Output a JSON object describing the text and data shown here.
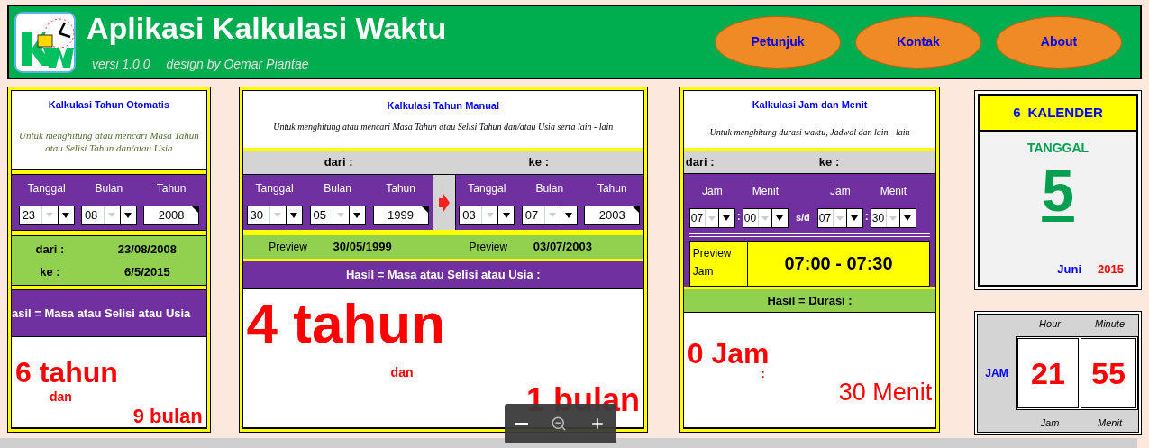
{
  "header": {
    "title": "Aplikasi Kalkulasi Waktu",
    "version": "versi 1.0.0",
    "credit": "design by Oemar Piantae",
    "nav": [
      "Petunjuk",
      "Kontak",
      "About"
    ]
  },
  "auto_panel": {
    "title": "Kalkulasi Tahun Otomatis",
    "description": "Untuk menghitung atau mencari Masa Tahun atau Selisi Tahun dan/atau Usia",
    "fields": [
      {
        "label": "Tanggal",
        "value": "23",
        "kind": "dropdown"
      },
      {
        "label": "Bulan",
        "value": "08",
        "kind": "dropdown"
      },
      {
        "label": "Tahun",
        "value": "2008",
        "kind": "input"
      }
    ],
    "summary": [
      {
        "label": "dari :",
        "value": "23/08/2008"
      },
      {
        "label": "ke :",
        "value": "6/5/2015"
      }
    ],
    "result_header": "asil = Masa atau Selisi atau Usia",
    "result": {
      "years": "6 tahun",
      "connector": "dan",
      "months": "9 bulan"
    }
  },
  "manual_panel": {
    "title": "Kalkulasi Tahun Manual",
    "description": "Untuk menghitung atau mencari Masa Tahun atau Selisi Tahun dan/atau Usia serta lain - lain",
    "from_label": "dari :",
    "to_label": "ke :",
    "from_fields": [
      {
        "label": "Tanggal",
        "value": "30",
        "kind": "dropdown"
      },
      {
        "label": "Bulan",
        "value": "05",
        "kind": "dropdown"
      },
      {
        "label": "Tahun",
        "value": "1999",
        "kind": "input"
      }
    ],
    "to_fields": [
      {
        "label": "Tanggal",
        "value": "03",
        "kind": "dropdown"
      },
      {
        "label": "Bulan",
        "value": "07",
        "kind": "dropdown"
      },
      {
        "label": "Tahun",
        "value": "2003",
        "kind": "input"
      }
    ],
    "previews": [
      {
        "label": "Preview",
        "value": "30/05/1999"
      },
      {
        "label": "Preview",
        "value": "03/07/2003"
      }
    ],
    "result_header": "Hasil = Masa atau Selisi atau Usia :",
    "result": {
      "years": "4 tahun",
      "connector": "dan",
      "months": "1 bulan"
    }
  },
  "time_panel": {
    "title": "Kalkulasi Jam dan Menit",
    "description": "Untuk menghitung durasi waktu, Jadwal dan lain - lain",
    "from_label": "dari :",
    "to_label": "ke :",
    "fields": [
      {
        "label": "Jam",
        "value": "07"
      },
      {
        "label": "Menit",
        "value": "00"
      },
      {
        "label": "Jam",
        "value": "07"
      },
      {
        "label": "Menit",
        "value": "30"
      }
    ],
    "colon": ":",
    "until": "s/d",
    "preview_label": "Preview Jam",
    "preview_value": "07:00 - 07:30",
    "result_header": "Hasil = Durasi :",
    "result": {
      "hours": "0 Jam",
      "separator": ":",
      "minutes": "30 Menit"
    }
  },
  "calendar": {
    "number": "6",
    "title": "KALENDER",
    "label": "TANGGAL",
    "day": "5",
    "month": "Juni",
    "year": "2015"
  },
  "clock": {
    "label": "JAM",
    "hour_caption": "Hour",
    "minute_caption": "Minute",
    "hour": "21",
    "minute": "55",
    "hour_footer": "Jam",
    "minute_footer": "Menit"
  }
}
